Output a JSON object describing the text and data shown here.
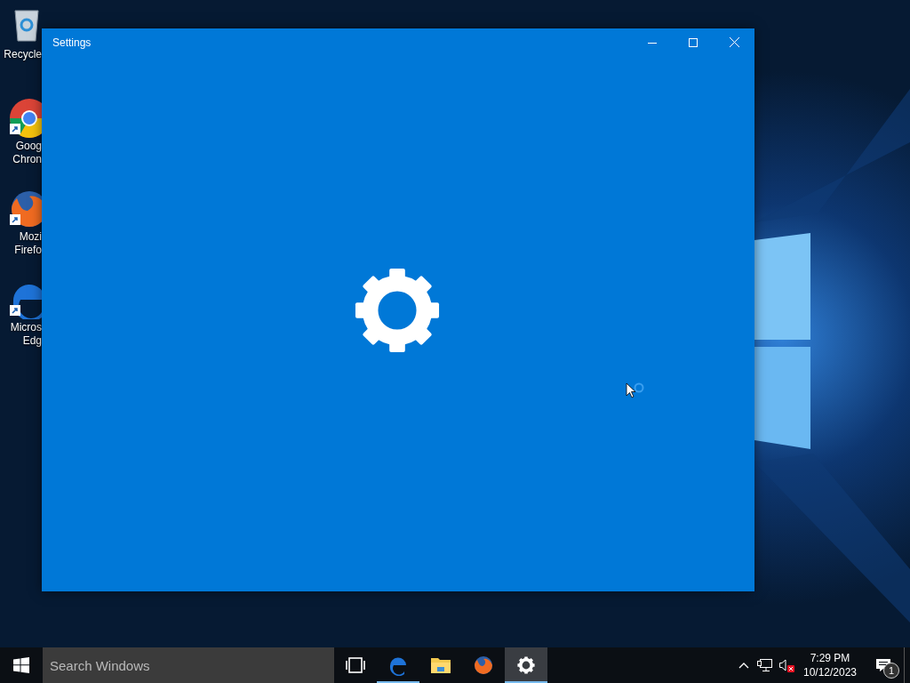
{
  "desktop": {
    "icons": [
      {
        "kind": "recycle",
        "lines": [
          "Recycle"
        ],
        "shortcut": false
      },
      {
        "kind": "chrome",
        "lines": [
          "Goog",
          "Chron"
        ],
        "shortcut": true
      },
      {
        "kind": "firefox",
        "lines": [
          "Mozi",
          "Firefo"
        ],
        "shortcut": true
      },
      {
        "kind": "edge",
        "lines": [
          "Micros",
          "Edg"
        ],
        "shortcut": true
      }
    ]
  },
  "window": {
    "title": "Settings"
  },
  "taskbar": {
    "search": {
      "placeholder": "Search Windows"
    },
    "apps": [
      {
        "kind": "taskview",
        "running": false,
        "active": false
      },
      {
        "kind": "edge",
        "running": true,
        "active": false
      },
      {
        "kind": "explorer",
        "running": false,
        "active": false
      },
      {
        "kind": "firefox",
        "running": false,
        "active": false
      },
      {
        "kind": "settings",
        "running": true,
        "active": true
      }
    ],
    "tray": {
      "muted": true,
      "time": "7:29 PM",
      "date": "10/12/2023",
      "notifications": "1"
    }
  }
}
